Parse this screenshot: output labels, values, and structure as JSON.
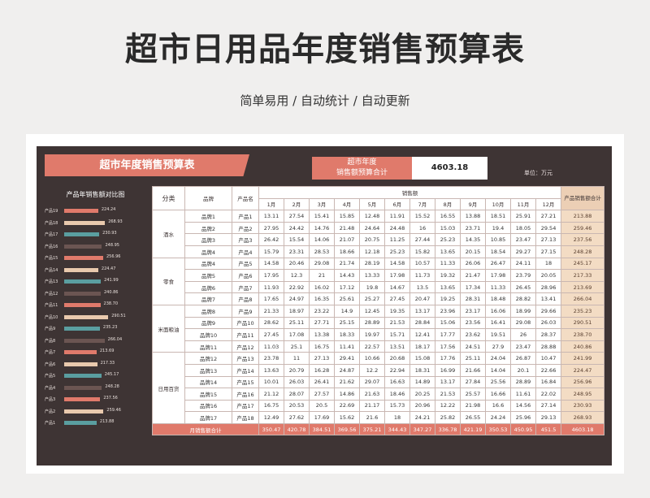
{
  "header": {
    "title": "超市日用品年度销售预算表",
    "subtitle": "简单易用  /  自动统计  /  自动更新"
  },
  "sheet": {
    "banner": "超市年度销售预算表",
    "budget_label_line1": "超市年度",
    "budget_label_line2": "销售额预算合计",
    "budget_value": "4603.18",
    "unit": "单位：万元"
  },
  "bar_panel": {
    "title": "产品年销售额对比图",
    "colors": [
      "#e07a6b",
      "#e9c9ad",
      "#5a9ea0",
      "#6b5552"
    ]
  },
  "table": {
    "col_headers": {
      "category": "分类",
      "brand": "品牌",
      "product": "产品名",
      "sales": "销售额",
      "total": "产品销售额合计"
    },
    "months": [
      "1月",
      "2月",
      "3月",
      "4月",
      "5月",
      "6月",
      "7月",
      "8月",
      "9月",
      "10月",
      "11月",
      "12月"
    ],
    "categories": [
      {
        "name": "酒水",
        "rows": 4
      },
      {
        "name": "零食",
        "rows": 4
      },
      {
        "name": "米面粮油",
        "rows": 4
      },
      {
        "name": "日用百货",
        "rows": 6
      }
    ],
    "rows": [
      {
        "brand": "品牌1",
        "product": "产品1",
        "values": [
          "13.11",
          "27.54",
          "15.41",
          "15.85",
          "12.48",
          "11.91",
          "15.52",
          "16.55",
          "13.88",
          "18.51",
          "25.91",
          "27.21"
        ],
        "total": "213.88"
      },
      {
        "brand": "品牌2",
        "product": "产品2",
        "values": [
          "27.95",
          "24.42",
          "14.76",
          "21.48",
          "24.64",
          "24.48",
          "16",
          "15.03",
          "23.71",
          "19.4",
          "18.05",
          "29.54"
        ],
        "total": "259.46"
      },
      {
        "brand": "品牌3",
        "product": "产品3",
        "values": [
          "26.42",
          "15.54",
          "14.06",
          "21.07",
          "20.75",
          "11.25",
          "27.44",
          "25.23",
          "14.35",
          "10.85",
          "23.47",
          "27.13"
        ],
        "total": "237.56"
      },
      {
        "brand": "品牌4",
        "product": "产品4",
        "values": [
          "15.79",
          "23.31",
          "28.53",
          "18.66",
          "12.18",
          "25.23",
          "15.82",
          "13.65",
          "20.15",
          "18.54",
          "29.27",
          "27.15"
        ],
        "total": "248.28"
      },
      {
        "brand": "品牌4",
        "product": "产品5",
        "values": [
          "14.58",
          "20.46",
          "29.08",
          "21.74",
          "28.19",
          "14.58",
          "10.57",
          "11.33",
          "26.06",
          "26.47",
          "24.11",
          "18"
        ],
        "total": "245.17"
      },
      {
        "brand": "品牌5",
        "product": "产品6",
        "values": [
          "17.95",
          "12.3",
          "21",
          "14.43",
          "13.33",
          "17.98",
          "11.73",
          "19.32",
          "21.47",
          "17.98",
          "23.79",
          "20.05"
        ],
        "total": "217.33"
      },
      {
        "brand": "品牌6",
        "product": "产品7",
        "values": [
          "11.93",
          "22.92",
          "16.02",
          "17.12",
          "19.8",
          "14.67",
          "13.5",
          "13.65",
          "17.34",
          "11.33",
          "26.45",
          "28.96"
        ],
        "total": "213.69"
      },
      {
        "brand": "品牌7",
        "product": "产品8",
        "values": [
          "17.65",
          "24.97",
          "16.35",
          "25.61",
          "25.27",
          "27.45",
          "20.47",
          "19.25",
          "28.31",
          "18.48",
          "28.82",
          "13.41"
        ],
        "total": "266.04"
      },
      {
        "brand": "品牌8",
        "product": "产品9",
        "values": [
          "21.33",
          "18.97",
          "23.22",
          "14.9",
          "12.45",
          "19.35",
          "13.17",
          "23.96",
          "23.17",
          "16.06",
          "18.99",
          "29.66"
        ],
        "total": "235.23"
      },
      {
        "brand": "品牌9",
        "product": "产品10",
        "values": [
          "28.62",
          "25.11",
          "27.71",
          "25.15",
          "28.89",
          "21.53",
          "28.84",
          "15.06",
          "23.56",
          "16.41",
          "29.08",
          "26.03"
        ],
        "total": "290.51"
      },
      {
        "brand": "品牌10",
        "product": "产品11",
        "values": [
          "27.45",
          "17.08",
          "13.38",
          "18.33",
          "19.97",
          "15.71",
          "12.41",
          "17.77",
          "23.62",
          "19.51",
          "26",
          "28.37"
        ],
        "total": "238.70"
      },
      {
        "brand": "品牌11",
        "product": "产品12",
        "values": [
          "11.03",
          "25.1",
          "16.75",
          "11.41",
          "22.57",
          "13.51",
          "18.17",
          "17.56",
          "24.51",
          "27.9",
          "23.47",
          "28.88"
        ],
        "total": "240.86"
      },
      {
        "brand": "品牌12",
        "product": "产品13",
        "values": [
          "23.78",
          "11",
          "27.13",
          "29.41",
          "10.66",
          "20.68",
          "15.08",
          "17.76",
          "25.11",
          "24.04",
          "26.87",
          "10.47"
        ],
        "total": "241.99"
      },
      {
        "brand": "品牌13",
        "product": "产品14",
        "values": [
          "13.63",
          "20.79",
          "16.28",
          "24.87",
          "12.2",
          "22.94",
          "18.31",
          "16.99",
          "21.66",
          "14.04",
          "20.1",
          "22.66"
        ],
        "total": "224.47"
      },
      {
        "brand": "品牌14",
        "product": "产品15",
        "values": [
          "10.01",
          "26.03",
          "26.41",
          "21.62",
          "29.07",
          "16.63",
          "14.89",
          "13.17",
          "27.84",
          "25.56",
          "28.89",
          "16.84"
        ],
        "total": "256.96"
      },
      {
        "brand": "品牌15",
        "product": "产品16",
        "values": [
          "21.12",
          "28.07",
          "27.57",
          "14.86",
          "21.63",
          "18.46",
          "20.25",
          "21.53",
          "25.57",
          "16.66",
          "11.61",
          "22.02"
        ],
        "total": "248.95"
      },
      {
        "brand": "品牌16",
        "product": "产品17",
        "values": [
          "16.75",
          "20.53",
          "20.5",
          "22.69",
          "21.17",
          "15.73",
          "20.96",
          "12.22",
          "21.98",
          "16.6",
          "14.56",
          "27.14"
        ],
        "total": "230.93"
      },
      {
        "brand": "品牌17",
        "product": "产品18",
        "values": [
          "12.49",
          "27.62",
          "17.69",
          "15.62",
          "21.6",
          "18",
          "24.21",
          "25.82",
          "26.55",
          "24.24",
          "25.96",
          "29.13"
        ],
        "total": "268.93"
      },
      {
        "brand": "品牌18",
        "product": "产品19",
        "values": [
          "18.88",
          "29.02",
          "12.66",
          "14.74",
          "19.26",
          "14.24",
          "29.93",
          "20.94",
          "13.15",
          "13.02",
          "25.7",
          "12.7"
        ],
        "total": "224.24"
      }
    ],
    "footer": {
      "label": "月销售额合计",
      "values": [
        "350.47",
        "420.78",
        "384.51",
        "369.56",
        "375.21",
        "344.43",
        "347.27",
        "336.78",
        "421.19",
        "350.53",
        "450.95",
        "451.5"
      ],
      "total": "4603.18"
    }
  },
  "chart_data": {
    "type": "bar",
    "title": "产品年销售额对比图",
    "categories": [
      "产品19",
      "产品18",
      "产品17",
      "产品16",
      "产品15",
      "产品14",
      "产品13",
      "产品12",
      "产品11",
      "产品10",
      "产品9",
      "产品8",
      "产品7",
      "产品6",
      "产品5",
      "产品4",
      "产品3",
      "产品2",
      "产品1"
    ],
    "values": [
      224.24,
      268.93,
      230.93,
      248.95,
      256.96,
      224.47,
      241.99,
      240.86,
      238.7,
      290.51,
      235.23,
      266.04,
      213.69,
      217.33,
      245.17,
      248.28,
      237.56,
      259.46,
      213.88
    ],
    "value_labels": [
      "224.24",
      "268.93",
      "230.93",
      "248.95",
      "256.96",
      "224.47",
      "241.99",
      "240.86",
      "238.70",
      "290.51",
      "235.23",
      "266.04",
      "213.69",
      "217.33",
      "245.17",
      "248.28",
      "237.56",
      "259.46",
      "213.88"
    ],
    "orientation": "horizontal",
    "xlim": [
      0,
      300
    ]
  }
}
